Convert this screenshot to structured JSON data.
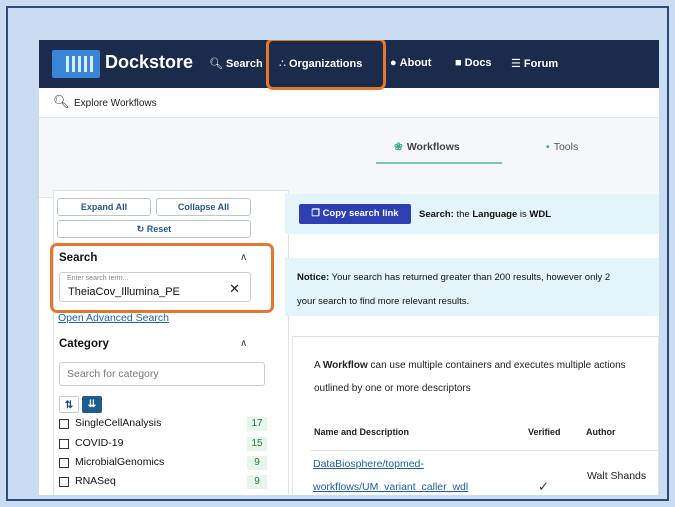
{
  "navbar": {
    "brand": "Dockstore",
    "items": [
      {
        "label": "Search",
        "icon": "search-icon"
      },
      {
        "label": "Organizations",
        "icon": "organizations-icon"
      },
      {
        "label": "About",
        "icon": "about-icon"
      },
      {
        "label": "Docs",
        "icon": "docs-icon"
      },
      {
        "label": "Forum",
        "icon": "forum-icon"
      }
    ]
  },
  "explore": {
    "label": "Explore Workflows"
  },
  "tabs": [
    {
      "label": "Workflows",
      "active": true
    },
    {
      "label": "Tools",
      "active": false
    }
  ],
  "filters": {
    "expand_all": "Expand All",
    "collapse_all": "Collapse All",
    "reset": "Reset",
    "search": {
      "title": "Search",
      "placeholder": "Enter search term...",
      "value": "TheiaCov_Illumina_PE"
    },
    "advanced_link": "Open Advanced Search",
    "category": {
      "title": "Category",
      "search_placeholder": "Search for category",
      "items": [
        {
          "label": "SingleCellAnalysis",
          "count": "17"
        },
        {
          "label": "COVID-19",
          "count": "15"
        },
        {
          "label": "MicrobialGenomics",
          "count": "9"
        },
        {
          "label": "RNASeq",
          "count": "9"
        }
      ]
    }
  },
  "main": {
    "copy_button": "Copy search link",
    "search_summary": {
      "prefix": "Search:",
      "text1": " the ",
      "field": "Language",
      "text2": " is ",
      "value": "WDL"
    },
    "notice": {
      "label": "Notice:",
      "line1": " Your search has returned greater than 200 results, however only 2",
      "line2": "your search to find more relevant results."
    },
    "description": {
      "prefix": "A ",
      "bold": "Workflow",
      "line1": " can use multiple containers and executes multiple actions",
      "line2": "outlined by one or more descriptors"
    },
    "table": {
      "headers": [
        "Name and Description",
        "Verified",
        "Author"
      ],
      "rows": [
        {
          "name_line1": "DataBiosphere/topmed-",
          "name_line2": "workflows/UM_variant_caller_wdl",
          "verified": "✓",
          "author": "Walt Shands"
        }
      ]
    }
  },
  "colors": {
    "highlight": "#e8772e",
    "navbar": "#1b2b4b",
    "primary_button": "#2d3fb3",
    "link": "#1f5fa6"
  }
}
